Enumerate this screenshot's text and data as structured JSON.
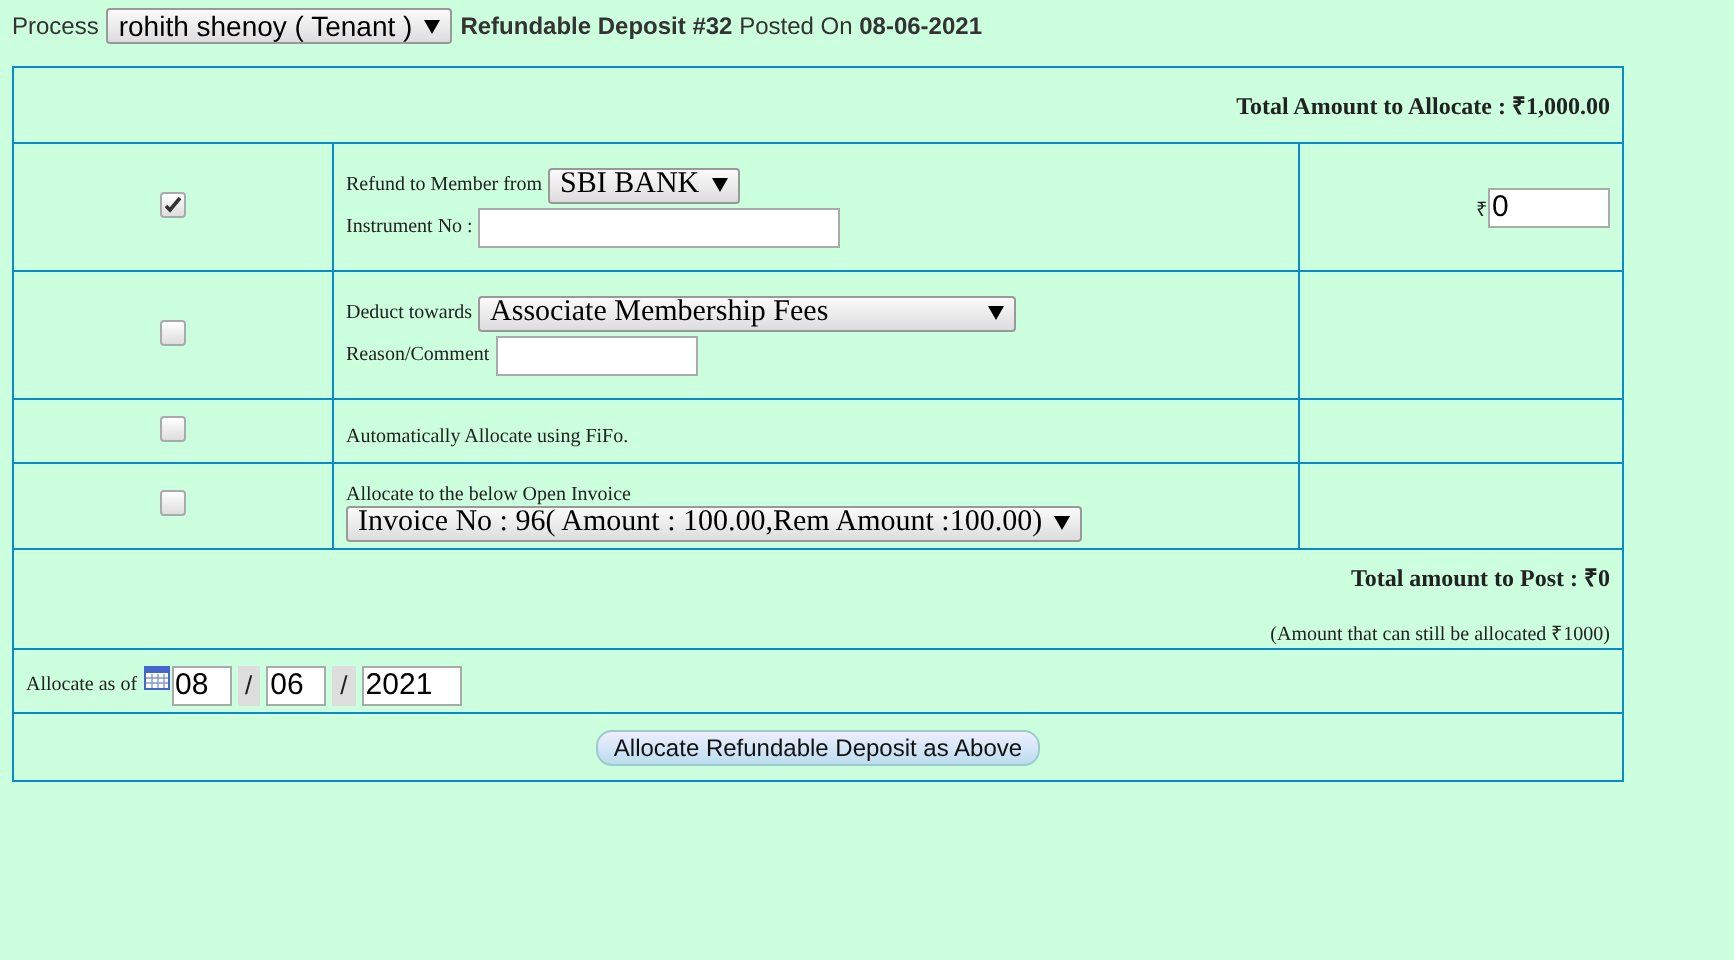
{
  "header": {
    "label": "Process",
    "member_select": "rohith shenoy ( Tenant )",
    "info": "**Refundable Deposit #32** Posted On **08-06-2021**"
  },
  "total_to_allocate": "Total Amount to Allocate : ₹1,000.00",
  "options": [
    {
      "kind": "bank",
      "checked": true,
      "label": "Refund to Member from",
      "select": "SBI BANK",
      "field_label": "Instrument No :",
      "currency": "₹",
      "amount": "0"
    },
    {
      "kind": "deduct",
      "checked": false,
      "label": "Deduct towards",
      "select": "Associate Membership Fees",
      "field_label": "Reason/Comment"
    },
    {
      "kind": "auto",
      "checked": false,
      "label": "Automatically Allocate using FiFo."
    },
    {
      "kind": "invoice",
      "checked": false,
      "label": "Allocate to the below Open Invoice",
      "select": "Invoice No : 96( Amount : 100.00,Rem Amount :100.00)"
    }
  ],
  "total_to_post": "Total amount to Post : ₹0",
  "remaining_note": "(Amount that can still be allocated ₹1000)",
  "allocate_date": {
    "label": "Allocate as of",
    "day": "08",
    "month": "06",
    "year": "2021",
    "separators": [
      "/",
      "/"
    ]
  },
  "submit": "Allocate Refundable Deposit as Above"
}
